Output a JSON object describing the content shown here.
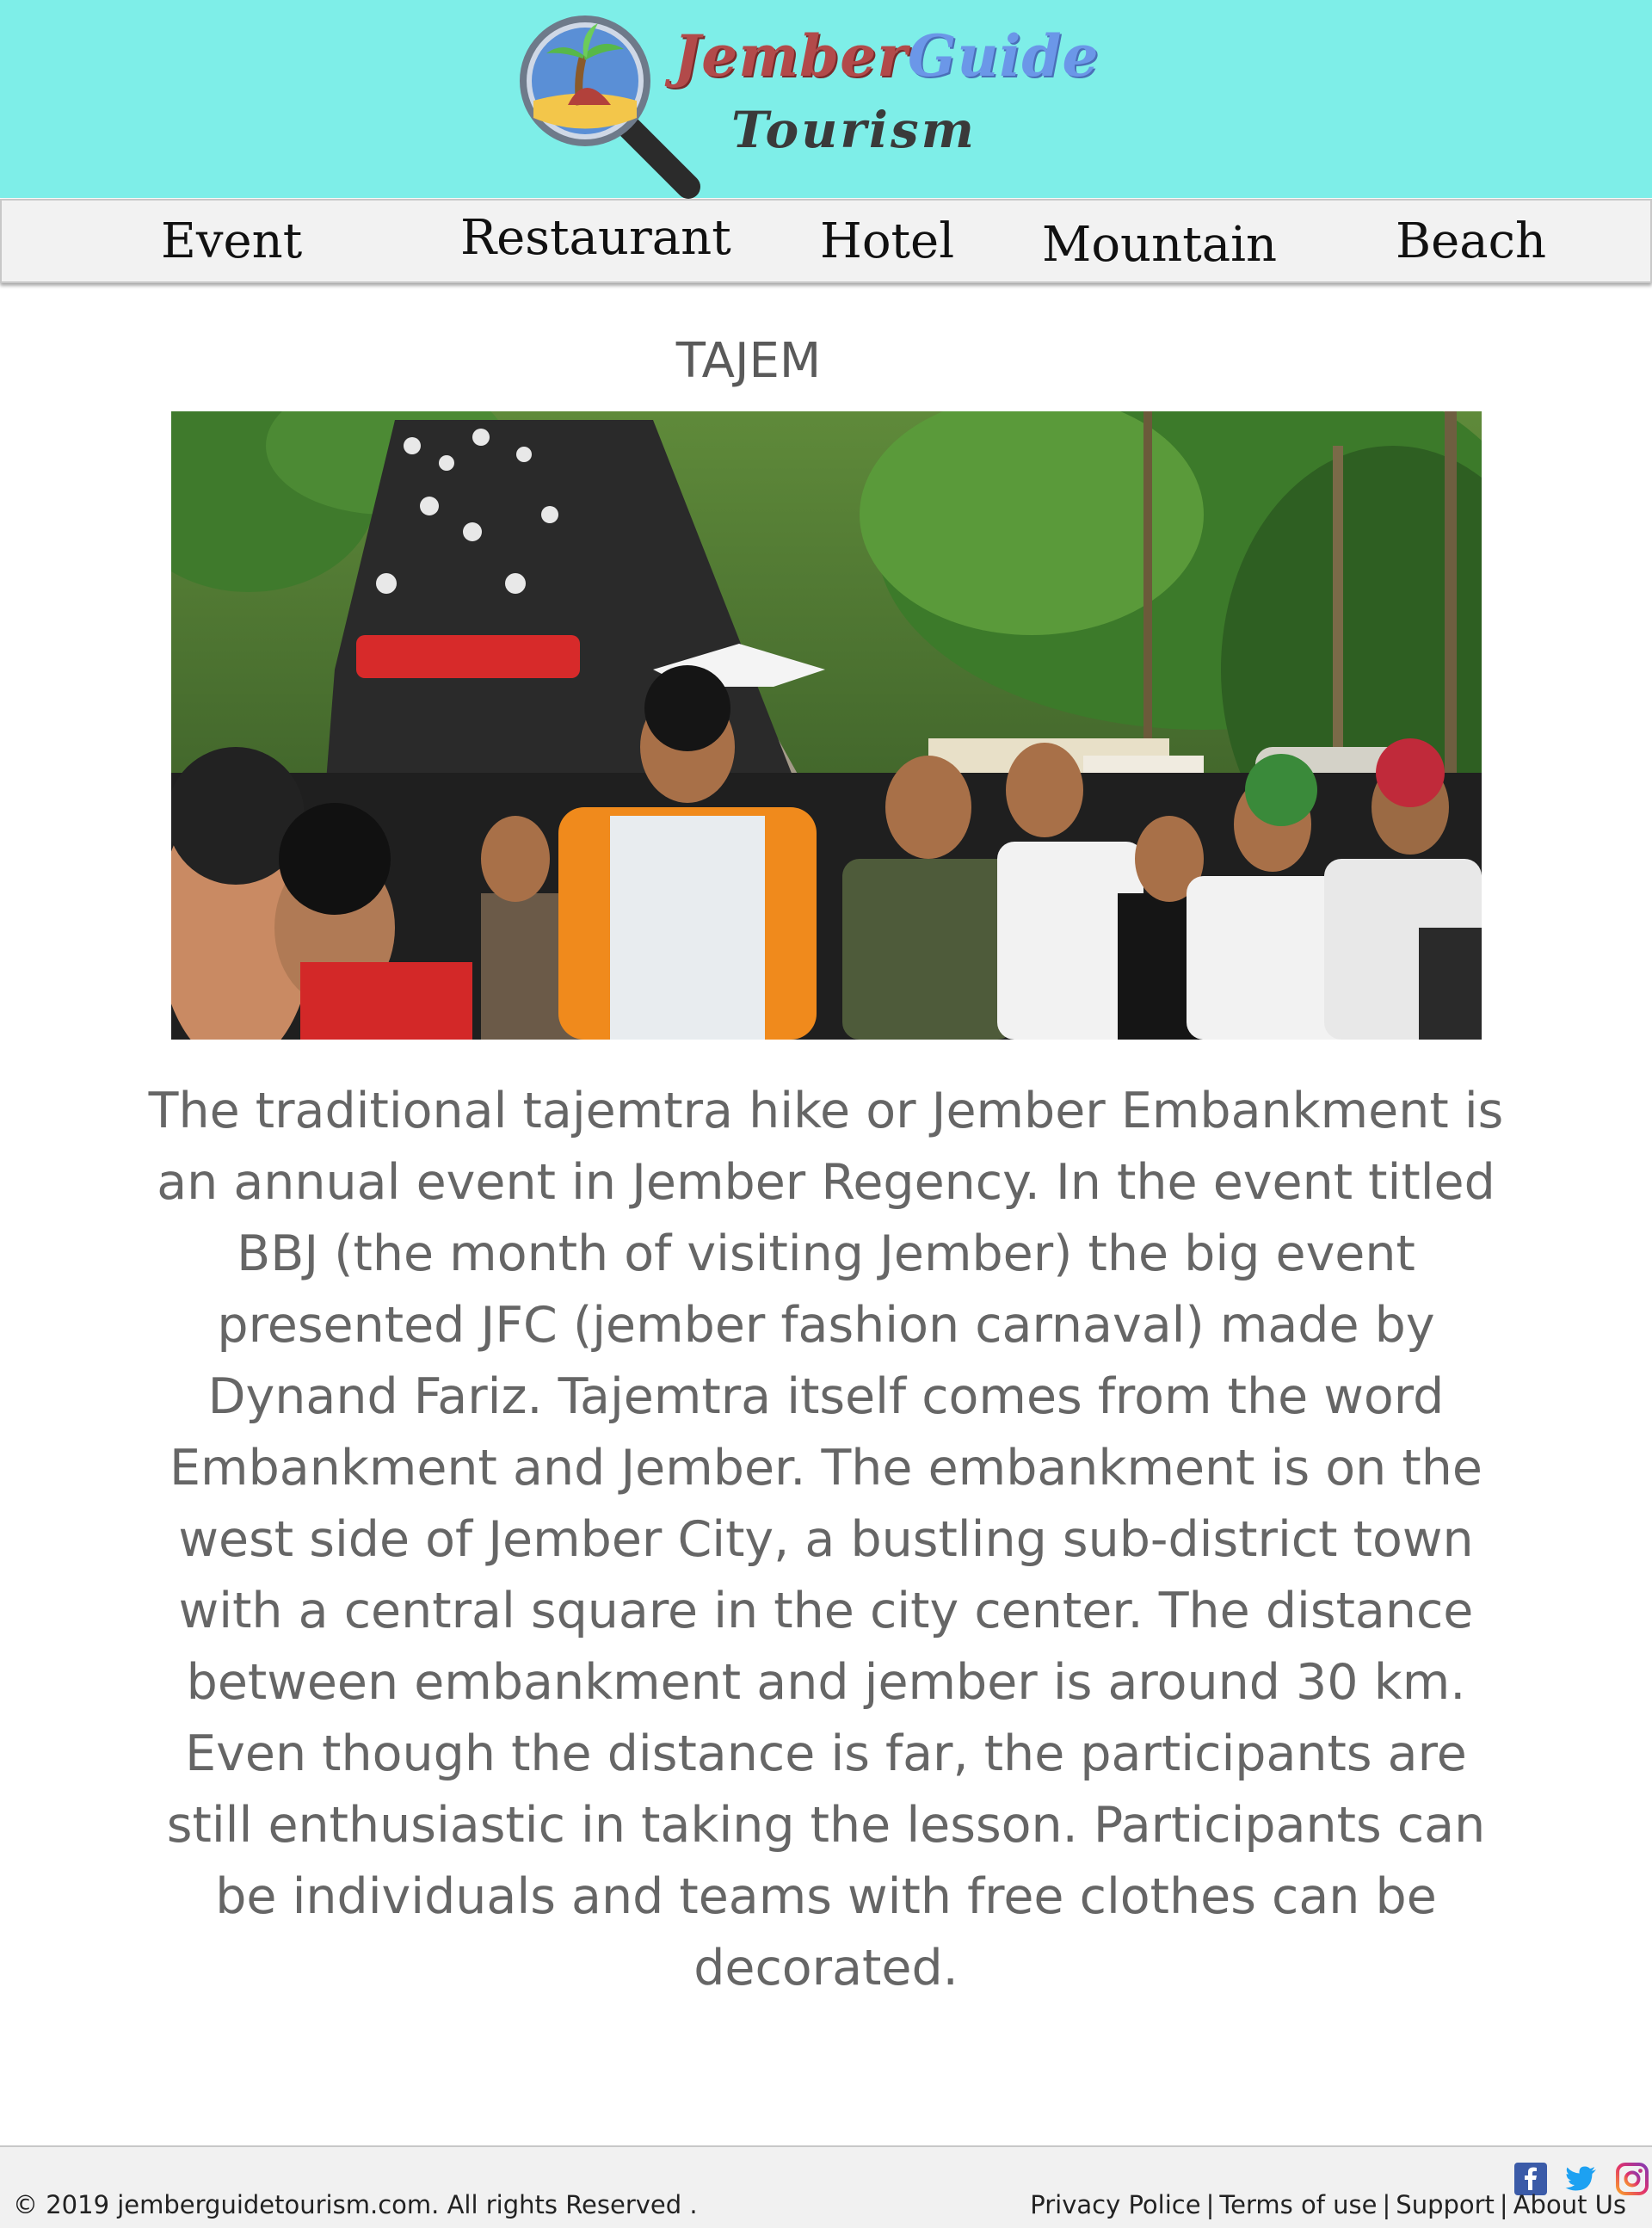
{
  "header": {
    "logo_part1": "Jember",
    "logo_part2": "Guide",
    "logo_sub": "Tourism"
  },
  "nav": {
    "items": [
      {
        "label": "Event"
      },
      {
        "label": "Restaurant"
      },
      {
        "label": "Hotel"
      },
      {
        "label": "Mountain"
      },
      {
        "label": "Beach"
      }
    ]
  },
  "main": {
    "title": "TAJEM",
    "photo_icon": "crowd-photo",
    "body": "The traditional tajemtra hike or Jember Embankment is an annual event in Jember Regency. In the event titled BBJ (the month of visiting Jember) the big event presented JFC (jember fashion carnaval) made by Dynand Fariz. Tajemtra itself comes from the word Embankment and Jember. The embankment is on the west side of Jember City, a bustling sub-district town with a central square in the city center. The distance between embankment and jember is around 30 km. Even though the distance is far, the participants are still enthusiastic in taking the lesson. Participants can be individuals and teams with free clothes can be decorated."
  },
  "footer": {
    "copyright": "© 2019 jemberguidetourism.com. All rights Reserved .",
    "links": [
      {
        "label": "Privacy Police"
      },
      {
        "label": "Terms of use"
      },
      {
        "label": "Support"
      },
      {
        "label": "About Us"
      }
    ],
    "separator": "|",
    "social": [
      "facebook-icon",
      "twitter-icon",
      "instagram-icon"
    ]
  },
  "colors": {
    "header_bg": "#7eeee8",
    "nav_bg": "#f2f2f2",
    "text_gray": "#666666",
    "logo_red": "#b24a4a",
    "logo_blue": "#6b97e8"
  }
}
